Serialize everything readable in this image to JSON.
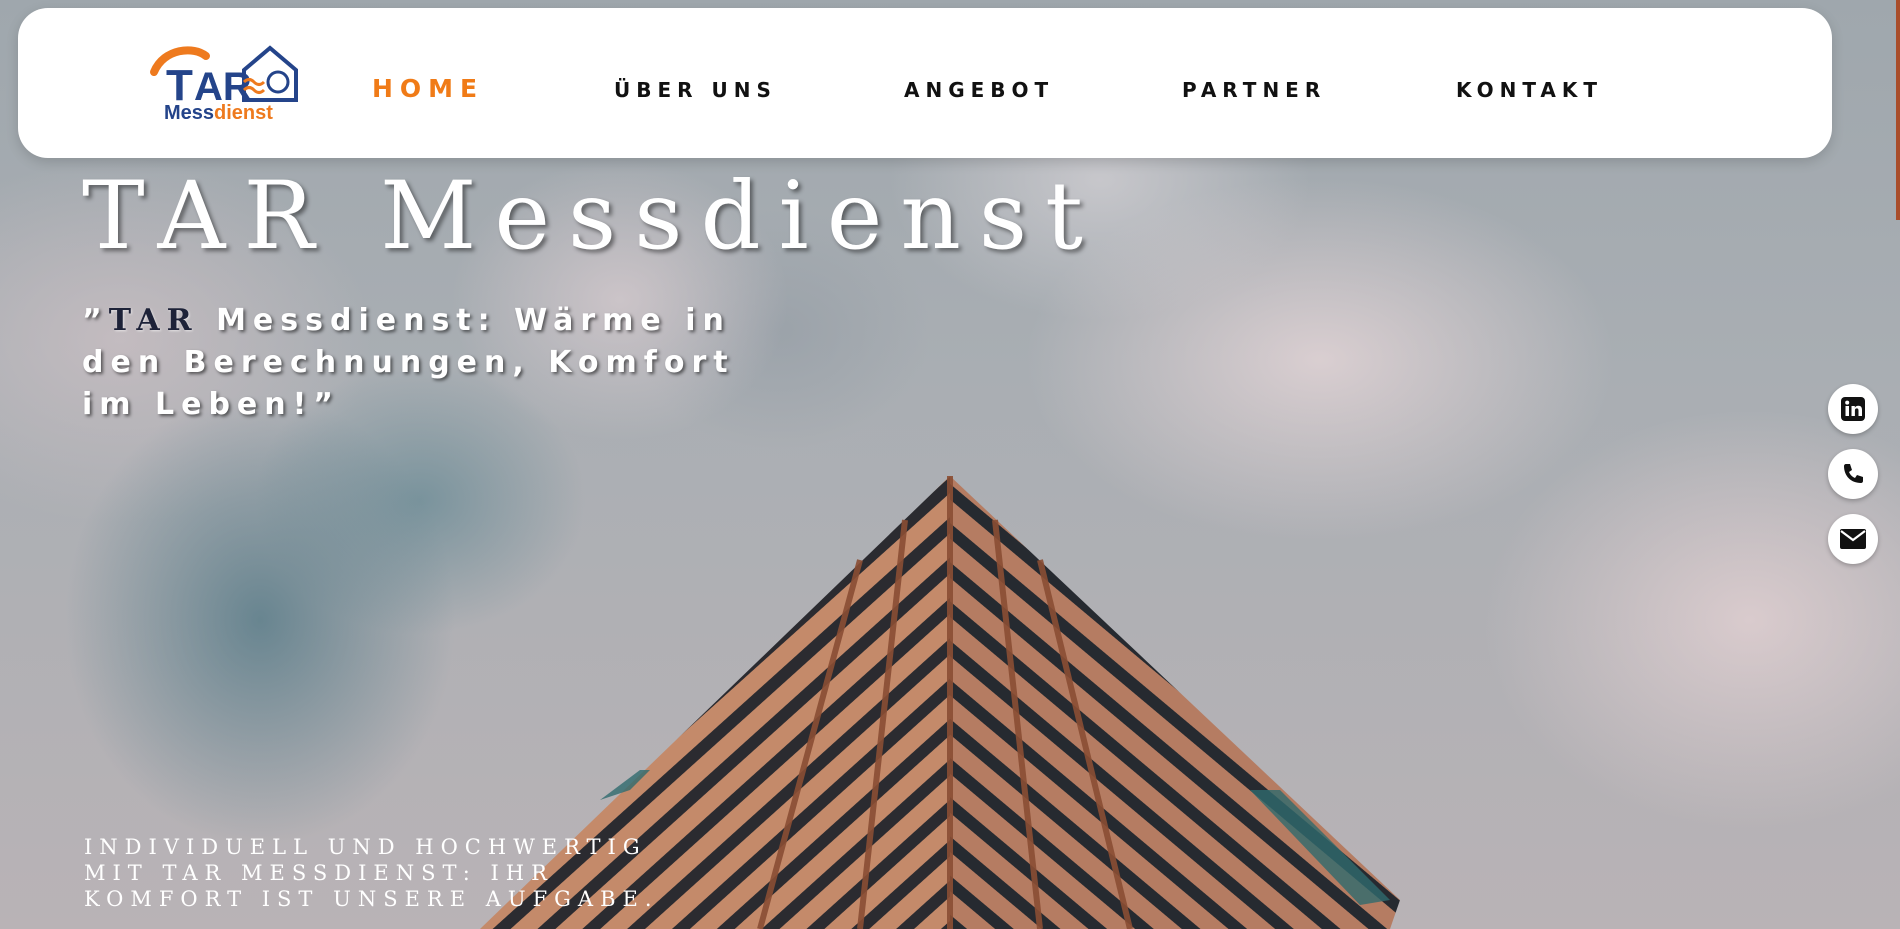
{
  "logo": {
    "mark_text": "TAR",
    "name_main": "Mess",
    "name_accent": "dienst",
    "colors": {
      "blue": "#24448a",
      "orange": "#ee7a1e"
    }
  },
  "nav": {
    "items": [
      {
        "label": "HOME",
        "active": true
      },
      {
        "label": "ÜBER UNS",
        "active": false
      },
      {
        "label": "ANGEBOT",
        "active": false
      },
      {
        "label": "PARTNER",
        "active": false
      },
      {
        "label": "KONTAKT",
        "active": false
      }
    ],
    "active_color": "#f07b17"
  },
  "hero": {
    "title": "TAR Messdienst",
    "slogan_open": "”",
    "slogan_brand": "TAR",
    "slogan_rest": " Messdienst: Wärme in den Berechnungen, Komfort im Leben!”",
    "tagline": "Individuell und hochwertig\nmit TAR Messdienst: Ihr\nKomfort ist unsere Aufgabe."
  },
  "social": [
    {
      "icon": "linkedin-icon"
    },
    {
      "icon": "phone-icon"
    },
    {
      "icon": "mail-icon"
    }
  ]
}
